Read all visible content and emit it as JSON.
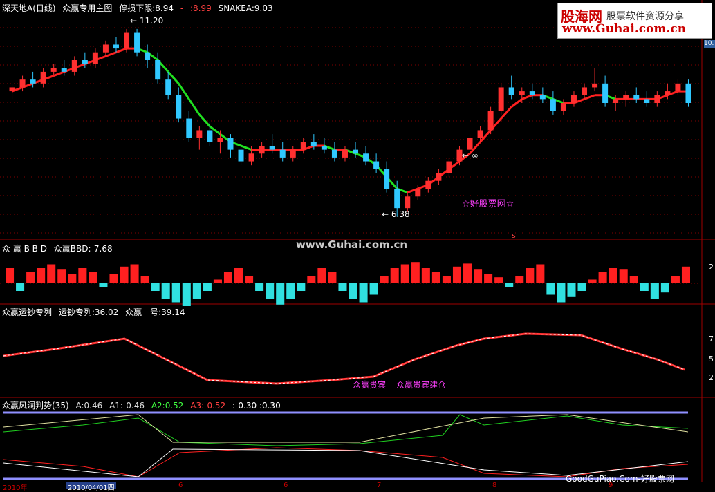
{
  "panel1": {
    "title": "深天地A(日线)",
    "indicator": "众赢专用主图",
    "stop_label": "停损下限:8.94",
    "mark1": "-",
    "mark2": ":8.99",
    "snake": "SNAKEA:9.03",
    "high_label": "← 11.20",
    "low_label": "← 6.38",
    "infinity_label": "← ∞",
    "star_label": "☆好股票网☆",
    "s_label": "s",
    "right_value": "10."
  },
  "panel2": {
    "title": "众 赢 B B D",
    "value": "众赢BBD:-7.68",
    "scale": "2"
  },
  "panel3": {
    "title": "众赢运钞专列",
    "value1": "运钞专列:36.02",
    "value2": "众赢一号:39.14",
    "label_a": "众赢贵宾",
    "label_b": "众赢贵宾建仓",
    "scales": [
      "7",
      "5",
      "2"
    ]
  },
  "panel4": {
    "title": "众赢风洞判势(35)",
    "a": "A:0.46",
    "a1": "A1:-0.46",
    "a2": "A2:0.52",
    "a3": "A3:-0.52",
    "extra": ":-0.30 :0.30"
  },
  "watermark": "www.Guhai.com.cn",
  "logo": {
    "big": "股海网",
    "sub": "股票软件资源分享",
    "url": "www.Guhai.com.cn"
  },
  "footer_brand": "GoodGuPiao.Com-好股票网",
  "x_axis": {
    "box": "2010/04/01四",
    "start": "2010年",
    "ticks": [
      "6",
      "6",
      "7",
      "8",
      "9"
    ]
  },
  "colors": {
    "up": "#ff3030",
    "down": "#30c8ff",
    "grid": "#800000",
    "ma_up": "#ff2020",
    "ma_down": "#20e020"
  },
  "chart_data": {
    "type": "candlestick",
    "ohlc": [
      [
        9.6,
        9.8,
        9.4,
        9.7
      ],
      [
        9.7,
        10.0,
        9.6,
        9.9
      ],
      [
        9.9,
        10.1,
        9.7,
        9.8
      ],
      [
        9.8,
        10.2,
        9.7,
        10.1
      ],
      [
        10.1,
        10.3,
        10.0,
        10.2
      ],
      [
        10.2,
        10.4,
        10.0,
        10.1
      ],
      [
        10.1,
        10.5,
        10.0,
        10.4
      ],
      [
        10.4,
        10.6,
        10.2,
        10.3
      ],
      [
        10.3,
        10.7,
        10.2,
        10.6
      ],
      [
        10.6,
        10.9,
        10.5,
        10.8
      ],
      [
        10.8,
        11.0,
        10.6,
        10.7
      ],
      [
        10.7,
        11.2,
        10.6,
        11.1
      ],
      [
        11.1,
        11.2,
        10.5,
        10.6
      ],
      [
        10.6,
        10.8,
        10.2,
        10.4
      ],
      [
        10.4,
        10.6,
        9.8,
        9.9
      ],
      [
        9.9,
        10.1,
        9.4,
        9.5
      ],
      [
        9.5,
        9.7,
        8.8,
        8.9
      ],
      [
        8.9,
        9.1,
        8.3,
        8.4
      ],
      [
        8.4,
        8.7,
        8.1,
        8.6
      ],
      [
        8.6,
        8.8,
        8.2,
        8.3
      ],
      [
        8.3,
        8.6,
        8.0,
        8.4
      ],
      [
        8.4,
        8.5,
        7.9,
        8.1
      ],
      [
        8.1,
        8.4,
        7.7,
        7.8
      ],
      [
        7.8,
        8.2,
        7.7,
        8.0
      ],
      [
        8.0,
        8.3,
        7.9,
        8.2
      ],
      [
        8.2,
        8.5,
        8.0,
        8.1
      ],
      [
        8.1,
        8.3,
        7.8,
        7.9
      ],
      [
        7.9,
        8.2,
        7.8,
        8.1
      ],
      [
        8.1,
        8.4,
        8.0,
        8.3
      ],
      [
        8.3,
        8.5,
        8.1,
        8.2
      ],
      [
        8.2,
        8.4,
        8.0,
        8.1
      ],
      [
        8.1,
        8.3,
        7.8,
        7.9
      ],
      [
        7.9,
        8.2,
        7.8,
        8.1
      ],
      [
        8.1,
        8.3,
        7.9,
        8.0
      ],
      [
        8.0,
        8.2,
        7.7,
        7.8
      ],
      [
        7.8,
        8.0,
        7.5,
        7.6
      ],
      [
        7.6,
        7.8,
        7.0,
        7.1
      ],
      [
        7.1,
        7.3,
        6.38,
        6.6
      ],
      [
        6.6,
        7.0,
        6.5,
        6.9
      ],
      [
        6.9,
        7.2,
        6.8,
        7.1
      ],
      [
        7.1,
        7.4,
        7.0,
        7.3
      ],
      [
        7.3,
        7.6,
        7.2,
        7.5
      ],
      [
        7.5,
        7.9,
        7.4,
        7.8
      ],
      [
        7.8,
        8.2,
        7.7,
        8.1
      ],
      [
        8.1,
        8.5,
        8.0,
        8.4
      ],
      [
        8.4,
        8.7,
        8.3,
        8.6
      ],
      [
        8.6,
        9.2,
        8.5,
        9.1
      ],
      [
        9.1,
        9.8,
        9.0,
        9.7
      ],
      [
        9.7,
        10.0,
        9.4,
        9.5
      ],
      [
        9.5,
        9.7,
        9.3,
        9.6
      ],
      [
        9.6,
        9.8,
        9.4,
        9.5
      ],
      [
        9.5,
        9.7,
        9.3,
        9.4
      ],
      [
        9.4,
        9.6,
        9.0,
        9.1
      ],
      [
        9.1,
        9.4,
        9.0,
        9.3
      ],
      [
        9.3,
        9.6,
        9.2,
        9.5
      ],
      [
        9.5,
        9.8,
        9.4,
        9.7
      ],
      [
        9.7,
        10.2,
        9.6,
        9.8
      ],
      [
        9.8,
        10.0,
        9.2,
        9.3
      ],
      [
        9.3,
        9.5,
        9.1,
        9.4
      ],
      [
        9.4,
        9.6,
        9.2,
        9.5
      ],
      [
        9.5,
        9.7,
        9.3,
        9.4
      ],
      [
        9.4,
        9.6,
        9.2,
        9.3
      ],
      [
        9.3,
        9.6,
        9.2,
        9.5
      ],
      [
        9.5,
        9.8,
        9.4,
        9.6
      ],
      [
        9.6,
        9.9,
        9.5,
        9.8
      ],
      [
        9.8,
        9.9,
        9.2,
        9.3
      ]
    ],
    "ma": [
      9.6,
      9.7,
      9.8,
      9.9,
      10.0,
      10.1,
      10.2,
      10.3,
      10.4,
      10.5,
      10.6,
      10.7,
      10.7,
      10.6,
      10.4,
      10.1,
      9.8,
      9.4,
      9.0,
      8.7,
      8.5,
      8.3,
      8.2,
      8.1,
      8.1,
      8.1,
      8.1,
      8.1,
      8.1,
      8.2,
      8.2,
      8.1,
      8.1,
      8.0,
      7.9,
      7.7,
      7.4,
      7.1,
      7.0,
      7.1,
      7.2,
      7.4,
      7.6,
      7.8,
      8.0,
      8.3,
      8.6,
      8.9,
      9.2,
      9.4,
      9.5,
      9.5,
      9.4,
      9.3,
      9.3,
      9.4,
      9.5,
      9.5,
      9.4,
      9.4,
      9.4,
      9.4,
      9.4,
      9.5,
      9.6,
      9.6
    ],
    "y_range": [
      6.0,
      11.5
    ],
    "bbd": [
      2,
      -1,
      1.5,
      2,
      2.5,
      1.8,
      1.2,
      2,
      1.5,
      -0.5,
      1.2,
      2.2,
      2.5,
      1,
      -1,
      -2,
      -2.5,
      -3,
      -2,
      -1,
      0.5,
      1.5,
      2,
      1,
      -1,
      -2,
      -2.8,
      -2,
      -1,
      1,
      2,
      1.5,
      -1,
      -2,
      -2.5,
      -1.5,
      1,
      2,
      2.5,
      2.8,
      2,
      1.5,
      1,
      2.2,
      2.6,
      1.8,
      1.2,
      0.8,
      -0.5,
      1,
      2,
      2.5,
      -1.5,
      -2.5,
      -1.8,
      -1,
      0.5,
      1.5,
      2,
      1.8,
      1,
      -1,
      -2,
      -1.2,
      1,
      2.2
    ]
  }
}
